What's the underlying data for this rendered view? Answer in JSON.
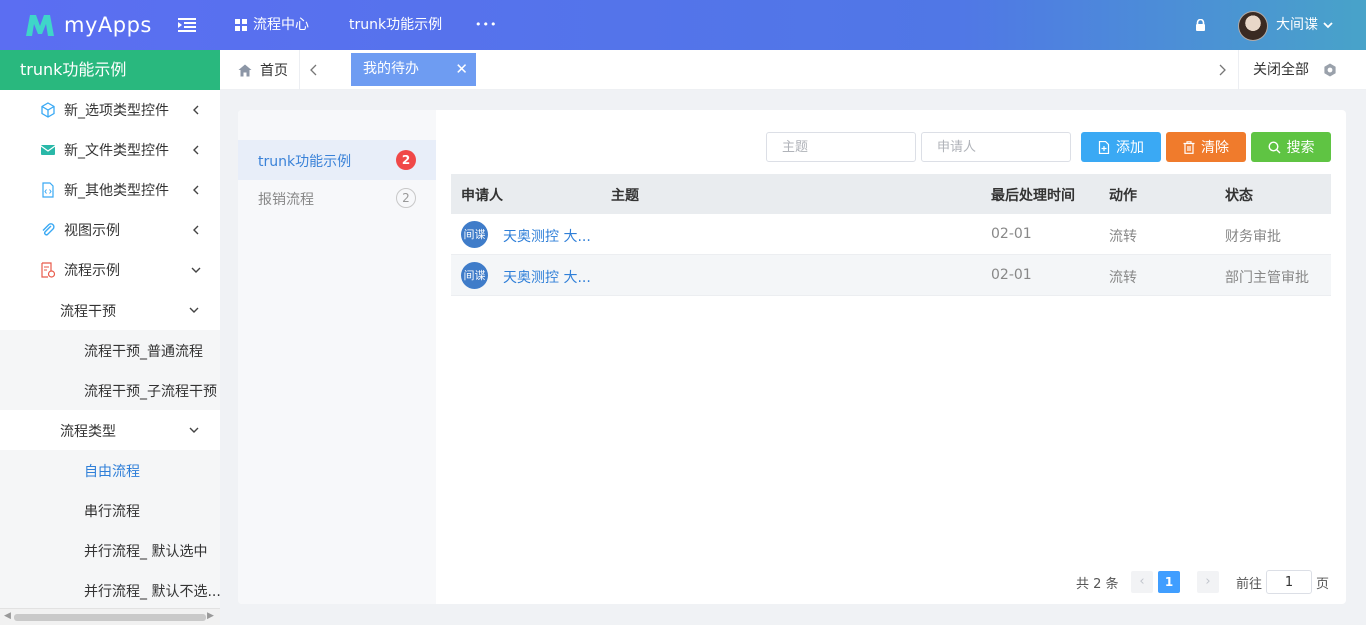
{
  "header": {
    "app_name": "myApps",
    "nav": [
      "流程中心",
      "trunk功能示例",
      "•••"
    ],
    "user_name": "大间谍"
  },
  "sidebar": {
    "title": "trunk功能示例",
    "items": [
      {
        "label": "新_选项类型控件"
      },
      {
        "label": "新_文件类型控件"
      },
      {
        "label": "新_其他类型控件"
      },
      {
        "label": "视图示例"
      },
      {
        "label": "流程示例"
      }
    ],
    "sub_groups": [
      {
        "label": "流程干预",
        "children": [
          "流程干预_普通流程",
          "流程干预_子流程干预"
        ]
      },
      {
        "label": "流程类型",
        "children": [
          "自由流程",
          "串行流程",
          "并行流程_ 默认选中",
          "并行流程_ 默认不选..."
        ]
      }
    ]
  },
  "tabs": {
    "home": "首页",
    "active": "我的待办",
    "close_all": "关闭全部"
  },
  "categories": [
    {
      "label": "trunk功能示例",
      "count": "2"
    },
    {
      "label": "报销流程",
      "count": "2"
    }
  ],
  "search": {
    "subject_placeholder": "主题",
    "applicant_placeholder": "申请人",
    "add_label": "添加",
    "clear_label": "清除",
    "search_label": "搜索"
  },
  "table": {
    "headers": [
      "申请人",
      "主题",
      "最后处理时间",
      "动作",
      "状态"
    ],
    "rows": [
      {
        "avatar": "间谍",
        "subject": "天奥测控 大...",
        "time": "02-01",
        "action": "流转",
        "status": "财务审批"
      },
      {
        "avatar": "间谍",
        "subject": "天奥测控 大...",
        "time": "02-01",
        "action": "流转",
        "status": "部门主管审批"
      }
    ]
  },
  "pager": {
    "total": "共 2 条",
    "page": "1",
    "goto_label": "前往",
    "goto_value": "1",
    "unit": "页"
  }
}
